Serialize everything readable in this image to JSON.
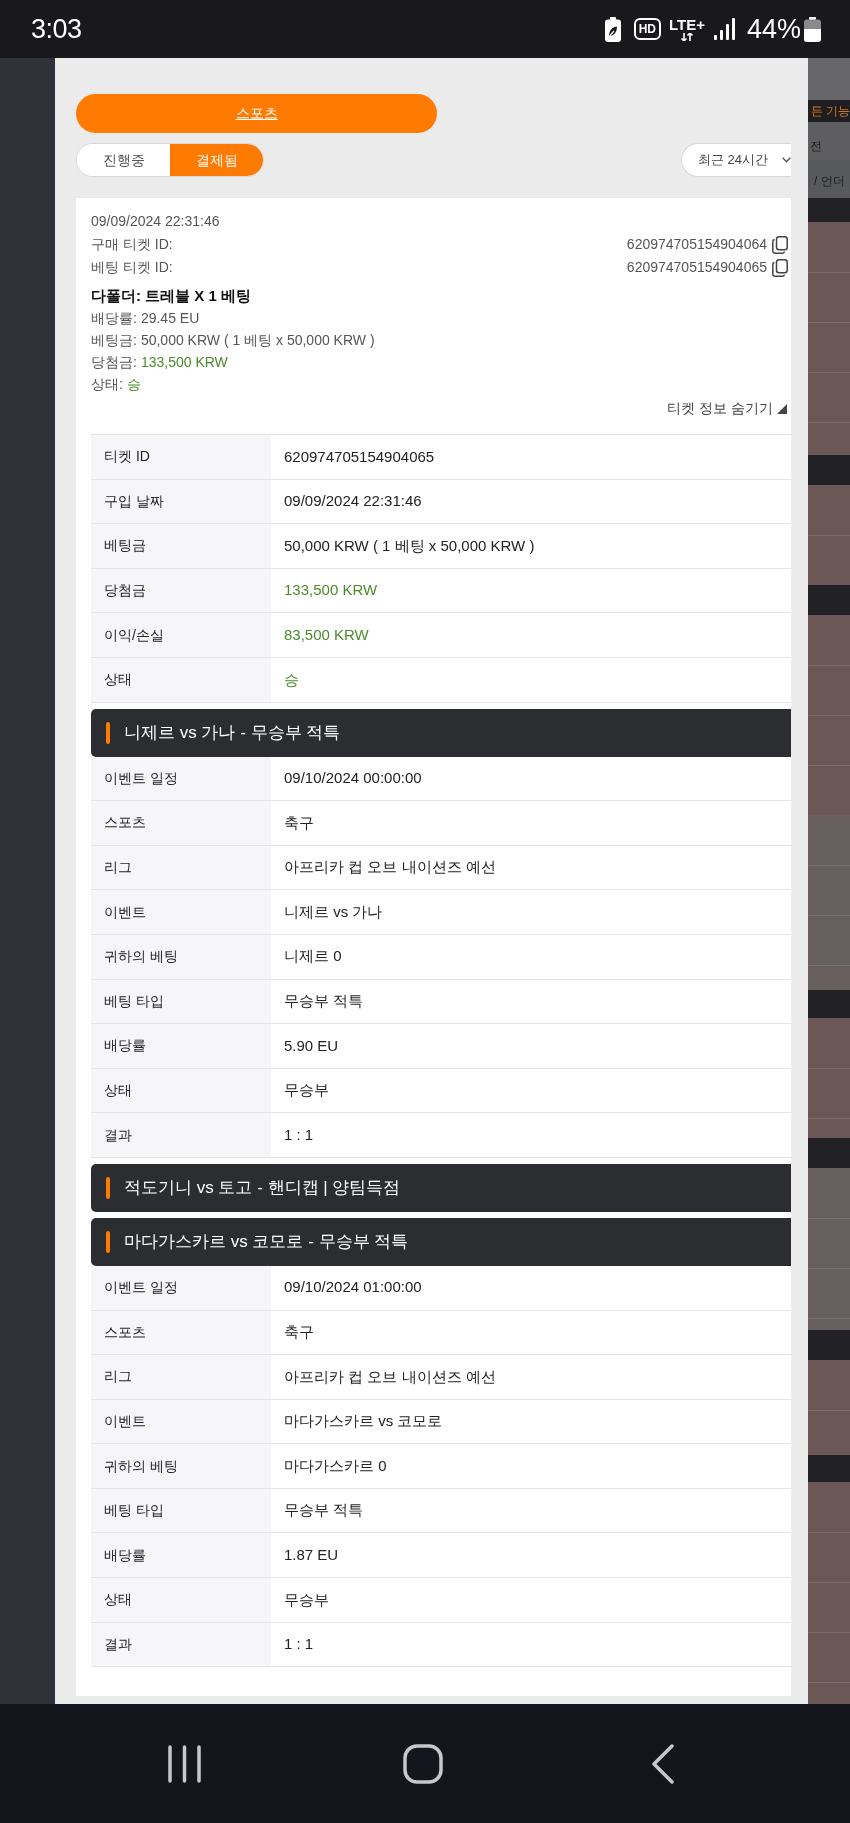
{
  "status_bar": {
    "time": "3:03",
    "hd": "HD",
    "network": "LTE+",
    "battery": "44%"
  },
  "sport_button": {
    "label": "스포츠"
  },
  "tabs": [
    {
      "label": "진행중",
      "selected": false
    },
    {
      "label": "결제됨",
      "selected": true
    }
  ],
  "period_dropdown": {
    "value": "최근 24시간"
  },
  "ticket": {
    "datetime": "09/09/2024 22:31:46",
    "ids": [
      {
        "label": "구매 티켓 ID:",
        "value": "620974705154904064"
      },
      {
        "label": "베팅 티켓 ID:",
        "value": "620974705154904065"
      }
    ],
    "title": "다폴더: 트레블 X 1 베팅",
    "summary": [
      {
        "label": "배당률:",
        "value": "29.45 EU",
        "positive": false
      },
      {
        "label": "베팅금:",
        "value": "50,000 KRW ( 1 베팅 x 50,000 KRW )",
        "positive": false
      },
      {
        "label": "당첨금:",
        "value": "133,500 KRW",
        "positive": true
      },
      {
        "label": "상태:",
        "value": "승",
        "positive": true
      }
    ],
    "toggle": {
      "label": "티켓 정보 숨기기",
      "expanded": true
    },
    "details": [
      {
        "label": "티켓 ID",
        "value": "620974705154904065",
        "positive": false
      },
      {
        "label": "구입 날짜",
        "value": "09/09/2024 22:31:46",
        "positive": false
      },
      {
        "label": "베팅금",
        "value": "50,000 KRW ( 1 베팅 x 50,000 KRW )",
        "positive": false
      },
      {
        "label": "당첨금",
        "value": "133,500 KRW",
        "positive": true
      },
      {
        "label": "이익/손실",
        "value": "83,500 KRW",
        "positive": true
      },
      {
        "label": "상태",
        "value": "승",
        "positive": true
      }
    ],
    "selections": [
      {
        "title": "니제르 vs 가나 - 무승부 적특",
        "rows": [
          {
            "label": "이벤트 일정",
            "value": "09/10/2024 00:00:00"
          },
          {
            "label": "스포츠",
            "value": "축구"
          },
          {
            "label": "리그",
            "value": "아프리카 컵 오브 내이션즈 예선"
          },
          {
            "label": "이벤트",
            "value": "니제르 vs 가나"
          },
          {
            "label": "귀하의 베팅",
            "value": "니제르 0"
          },
          {
            "label": "베팅 타입",
            "value": "무승부 적특"
          },
          {
            "label": "배당률",
            "value": "5.90 EU"
          },
          {
            "label": "상태",
            "value": "무승부"
          },
          {
            "label": "결과",
            "value": "1 : 1"
          }
        ]
      },
      {
        "title": "적도기니 vs 토고 - 핸디캡 | 양팀득점"
      },
      {
        "title": "마다가스카르 vs 코모로 - 무승부 적특",
        "rows": [
          {
            "label": "이벤트 일정",
            "value": "09/10/2024 01:00:00"
          },
          {
            "label": "스포츠",
            "value": "축구"
          },
          {
            "label": "리그",
            "value": "아프리카 컵 오브 내이션즈 예선"
          },
          {
            "label": "이벤트",
            "value": "마다가스카르 vs 코모로"
          },
          {
            "label": "귀하의 베팅",
            "value": "마다가스카르 0"
          },
          {
            "label": "베팅 타입",
            "value": "무승부 적특"
          },
          {
            "label": "배당률",
            "value": "1.87 EU"
          },
          {
            "label": "상태",
            "value": "무승부"
          },
          {
            "label": "결과",
            "value": "1 : 1"
          }
        ]
      }
    ]
  },
  "background_page": {
    "texts": [
      "든 기능",
      "전",
      "/ 언더"
    ]
  }
}
